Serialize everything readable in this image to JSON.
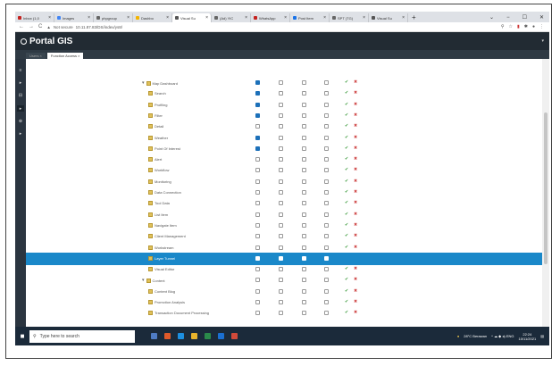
{
  "browser": {
    "tabs": [
      {
        "label": "Inbox (1,0",
        "fav_color": "#c5221f"
      },
      {
        "label": "Images",
        "fav_color": "#4285f4"
      },
      {
        "label": "phpgroup",
        "fav_color": "#666666"
      },
      {
        "label": "Dashbo",
        "fav_color": "#f4b400"
      },
      {
        "label": "Visual Su",
        "fav_color": "#555555",
        "active": true
      },
      {
        "label": "(Ad) YIC",
        "fav_color": "#666666"
      },
      {
        "label": "WhatsApp",
        "fav_color": "#c5221f"
      },
      {
        "label": "Post Item",
        "fav_color": "#1a73e8"
      },
      {
        "label": "SPT (TG)",
        "fav_color": "#666666"
      },
      {
        "label": "Visual Su",
        "fav_color": "#555555"
      }
    ],
    "new_tab": "+",
    "window_controls": [
      "⌄",
      "−",
      "☐",
      "✕"
    ],
    "security_label": "Not secure",
    "url": "10.11.87.83/DS/index/ys8/"
  },
  "app": {
    "title": "Portal GIS",
    "user_menu": "▾",
    "subtabs": [
      "Users ×",
      "Function Access ×"
    ]
  },
  "rail_icons": [
    "≡",
    "▸",
    "⊟",
    "▸",
    "⊕",
    "▸"
  ],
  "tree": {
    "rows": [
      {
        "label": "Map Dashboard",
        "level": 0,
        "expander": "▾",
        "checks": [
          true,
          false,
          false,
          false
        ],
        "actions": true
      },
      {
        "label": "Search",
        "level": 1,
        "checks": [
          true,
          false,
          false,
          false
        ],
        "actions": true
      },
      {
        "label": "Profiling",
        "level": 1,
        "checks": [
          true,
          false,
          false,
          false
        ],
        "actions": true
      },
      {
        "label": "Filter",
        "level": 1,
        "checks": [
          true,
          false,
          false,
          false
        ],
        "actions": true
      },
      {
        "label": "Detail",
        "level": 1,
        "checks": [
          false,
          false,
          false,
          false
        ],
        "actions": true
      },
      {
        "label": "Weather",
        "level": 1,
        "checks": [
          true,
          false,
          false,
          false
        ],
        "actions": true
      },
      {
        "label": "Point Of Interest",
        "level": 1,
        "checks": [
          true,
          false,
          false,
          false
        ],
        "actions": true
      },
      {
        "label": "Alert",
        "level": 1,
        "checks": [
          false,
          false,
          false,
          false
        ],
        "actions": true
      },
      {
        "label": "Workflow",
        "level": 1,
        "checks": [
          false,
          false,
          false,
          false
        ],
        "actions": true
      },
      {
        "label": "Monitoring",
        "level": 1,
        "checks": [
          false,
          false,
          false,
          false
        ],
        "actions": true
      },
      {
        "label": "Data Connection",
        "level": 1,
        "checks": [
          false,
          false,
          false,
          false
        ],
        "actions": true
      },
      {
        "label": "Tool Data",
        "level": 1,
        "checks": [
          false,
          false,
          false,
          false
        ],
        "actions": true
      },
      {
        "label": "List Item",
        "level": 1,
        "checks": [
          false,
          false,
          false,
          false
        ],
        "actions": true
      },
      {
        "label": "Navigate Item",
        "level": 1,
        "checks": [
          false,
          false,
          false,
          false
        ],
        "actions": true
      },
      {
        "label": "Client Management",
        "level": 1,
        "checks": [
          false,
          false,
          false,
          false
        ],
        "actions": true
      },
      {
        "label": "Workstream",
        "level": 1,
        "checks": [
          false,
          false,
          false,
          false
        ],
        "actions": true
      },
      {
        "label": "Layer Tunnel",
        "level": 1,
        "checks": [
          true,
          true,
          true,
          true
        ],
        "actions": false,
        "highlight": true
      },
      {
        "label": "Visual Editor",
        "level": 1,
        "checks": [
          false,
          false,
          false,
          false
        ],
        "actions": true
      },
      {
        "label": "Content",
        "level": 0,
        "expander": "▾",
        "checks": [
          false,
          false,
          false,
          false
        ],
        "actions": true
      },
      {
        "label": "Content Blog",
        "level": 1,
        "checks": [
          false,
          false,
          false,
          false
        ],
        "actions": true
      },
      {
        "label": "Promotion Analysis",
        "level": 1,
        "checks": [
          false,
          false,
          false,
          false
        ],
        "actions": true
      },
      {
        "label": "Transaction Document Processing",
        "level": 1,
        "checks": [
          false,
          false,
          false,
          false
        ],
        "actions": true
      }
    ],
    "action_ok": "✔",
    "action_del": "✖"
  },
  "taskbar": {
    "start_icon": "■",
    "search_placeholder": "Type here to search",
    "app_icons": [
      "#4f7cc4",
      "#e05a2a",
      "#1d8fe0",
      "#e8b32c",
      "#2a8a4a",
      "#1b6fd1",
      "#d14a3a"
    ],
    "weather": "28°C Berawan",
    "tray": "^  ☁  ◆  ◂)  ENG",
    "time": "22:24",
    "date": "10/11/2021"
  },
  "colors": {
    "highlight": "#1a88c9",
    "check_on": "#1c70b9"
  }
}
